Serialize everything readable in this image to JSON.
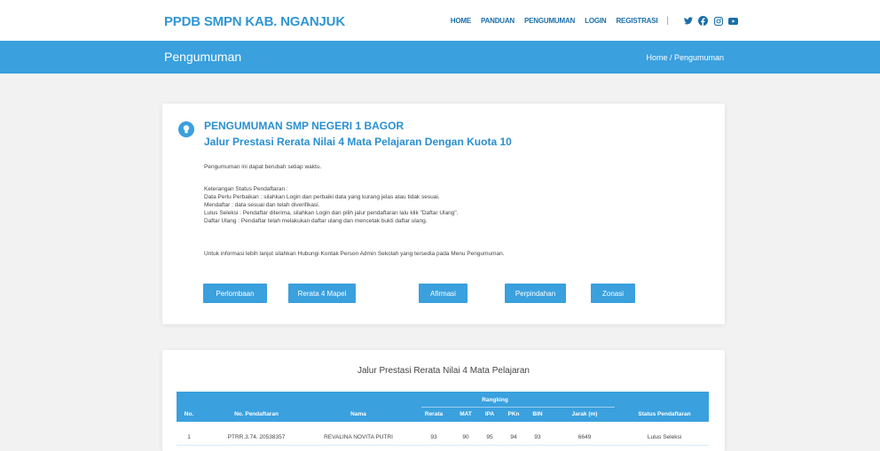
{
  "header": {
    "brand": "PPDB SMPN KAB. NGANJUK",
    "nav": [
      "HOME",
      "PANDUAN",
      "PENGUMUMAN",
      "LOGIN",
      "REGISTRASI"
    ],
    "separator": "|",
    "social_icons": [
      "twitter-icon",
      "facebook-icon",
      "instagram-icon",
      "youtube-icon"
    ]
  },
  "banner": {
    "title": "Pengumuman",
    "breadcrumb": "Home / Pengumuman"
  },
  "announcement": {
    "title": "PENGUMUMAN SMP NEGERI 1 BAGOR",
    "subtitle": "Jalur Prestasi Rerata Nilai 4 Mata Pelajaran Dengan Kuota 10",
    "notice": "Pengumuman ini dapat berubah setiap waktu.",
    "status_heading": "Keterangan Status Pendaftaran :",
    "status_lines": [
      "Data Perlu Perbaikan : silahkan Login dan perbaiki data yang kurang jelas atau tidak sesuai.",
      "Mendaftar : data sesuai dan telah diverifikasi.",
      "Lulus Seleksi : Pendaftar diterima, silahkan Login dan pilih jalur pendaftaran lalu klik \"Daftar Ulang\".",
      "Daftar Ulang : Pendaftar telah melakukan daftar ulang dan mencetak bukti daftar ulang."
    ],
    "contact_info": "Untuk informasi lebih lanjut silahkan Hubungi Kontak Person Admin Sekolah yang tersedia pada Menu Pengumuman.",
    "buttons": [
      "Perlombaan",
      "Rerata 4 Mapel",
      "Afirmasi",
      "Perpindahan",
      "Zonasi"
    ]
  },
  "results": {
    "title": "Jalur Prestasi Rerata Nilai 4 Mata Pelajaran",
    "group_header": "Rangking",
    "columns": [
      "No.",
      "No. Pendaftaran",
      "Nama",
      "Rerata",
      "MAT",
      "IPA",
      "PKn",
      "BIN",
      "Jarak (m)",
      "Status Pendaftaran"
    ],
    "rows": [
      [
        "1",
        "PTRR.3.74. 20538357",
        "REVALINA NOVITA PUTRI",
        "93",
        "90",
        "95",
        "94",
        "93",
        "6649",
        "Lulus Seleksi"
      ]
    ]
  },
  "colors": {
    "accent": "#3aa0de",
    "brand_text": "#3096d3",
    "heading_text": "#2a8fd0"
  }
}
